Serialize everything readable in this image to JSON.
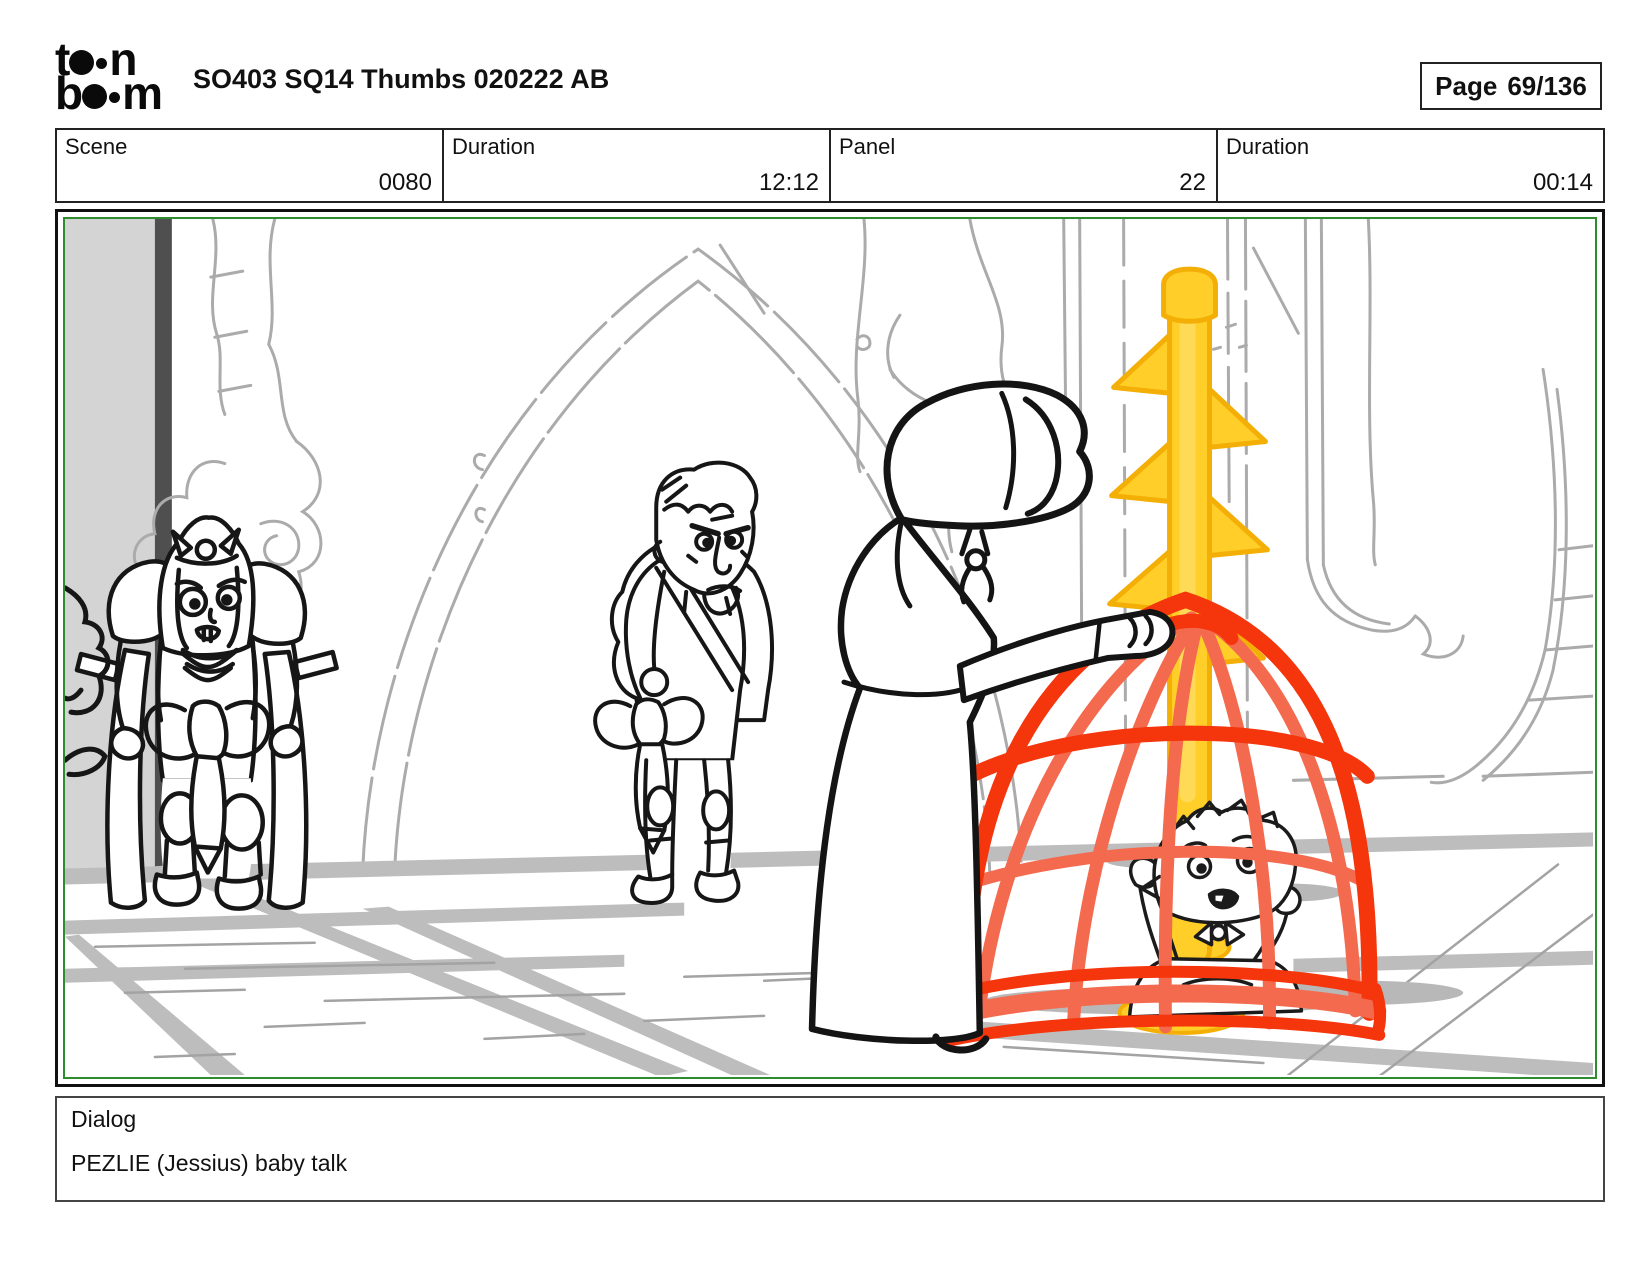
{
  "header": {
    "logo": {
      "top_left": "t",
      "top_right": "n",
      "bottom_left": "b",
      "bottom_right": "m"
    },
    "title": "SO403 SQ14 Thumbs 020222 AB",
    "page": {
      "label": "Page",
      "value": "69/136"
    }
  },
  "info_table": {
    "cells": [
      {
        "label": "Scene",
        "value": "0080"
      },
      {
        "label": "Duration",
        "value": "12:12"
      },
      {
        "label": "Panel",
        "value": "22"
      },
      {
        "label": "Duration",
        "value": "00:14"
      }
    ]
  },
  "storyboard_panel": {
    "frame_color": "#2e8b2e",
    "cage_red": "#f5350c",
    "cage_salmon": "#f46a4e",
    "mace_yellow": "#ffce29",
    "mace_outline": "#f4af06",
    "sketch_gray": "#ababab",
    "floor_gray": "#bdbdbd",
    "ink_black": "#161616"
  },
  "dialog": {
    "label": "Dialog",
    "text": "PEZLIE (Jessius) baby talk"
  }
}
